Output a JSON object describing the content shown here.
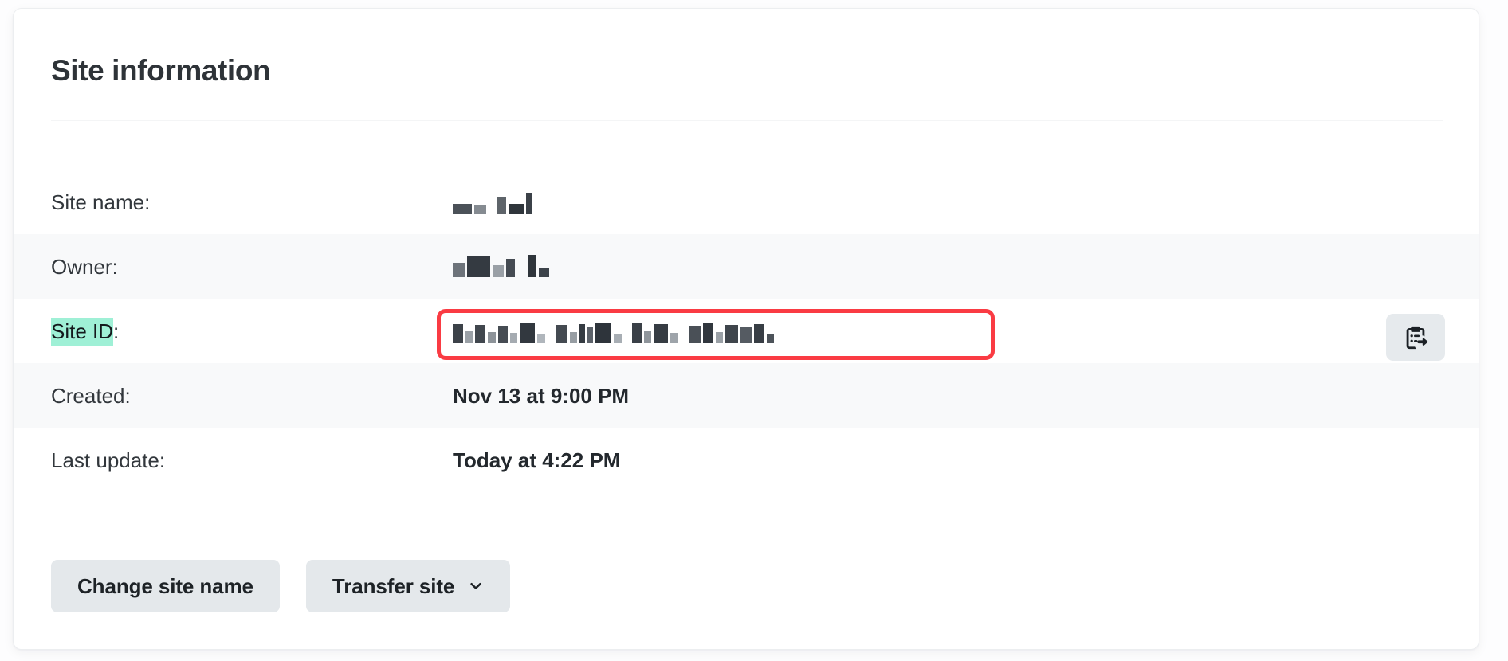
{
  "card": {
    "title": "Site information"
  },
  "rows": [
    {
      "label": "Site name",
      "label_suffix": ":",
      "value": "",
      "redacted": true,
      "highlighted": false,
      "zebra": false
    },
    {
      "label": "Owner",
      "label_suffix": ":",
      "value": "",
      "redacted": true,
      "highlighted": false,
      "zebra": true
    },
    {
      "label": "Site ID",
      "label_suffix": ":",
      "value": "",
      "redacted": true,
      "highlighted": true,
      "zebra": false
    },
    {
      "label": "Created",
      "label_suffix": ":",
      "value": "Nov 13 at 9:00 PM",
      "redacted": false,
      "highlighted": false,
      "zebra": true
    },
    {
      "label": "Last update",
      "label_suffix": ":",
      "value": "Today at 4:22 PM",
      "redacted": false,
      "highlighted": false,
      "zebra": false
    }
  ],
  "copy_button": {
    "icon": "clipboard-paste-icon",
    "label": ""
  },
  "annotation": {
    "shape": "rounded-rectangle",
    "color": "#fa3b43",
    "targets": "site-id-value"
  },
  "selection_highlight": {
    "color": "#9ff0d6",
    "target": "site-id-label"
  },
  "buttons": [
    {
      "label": "Change site name",
      "icon": ""
    },
    {
      "label": "Transfer site",
      "icon": "chevron-down-icon"
    }
  ],
  "colors": {
    "card_background": "#ffffff",
    "zebra_row": "#f8f9fa",
    "title_text": "#2e3338",
    "label_text": "#32373c",
    "value_text": "#23282d",
    "button_background": "#e4e8eb",
    "button_text": "#1d2226",
    "annotation_red": "#fa3b43",
    "selection_green": "#9ff0d6",
    "copy_button_background": "#e6eaed"
  }
}
